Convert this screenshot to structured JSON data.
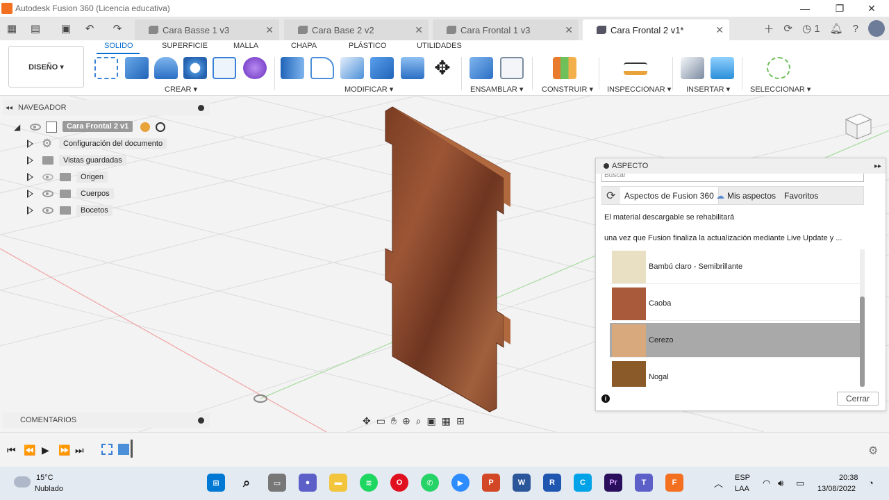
{
  "window": {
    "title": "Autodesk Fusion 360 (Licencia educativa)"
  },
  "tabs": [
    {
      "label": "Cara Basse 1 v3"
    },
    {
      "label": "Cara Base 2 v2"
    },
    {
      "label": "Cara Frontal 1 v3"
    },
    {
      "label": "Cara Frontal 2 v1*"
    }
  ],
  "header": {
    "job_count": "1"
  },
  "toolbar": {
    "design_label": "DISEÑO ▾",
    "workspace_tabs": [
      "SOLIDO",
      "SUPERFICIE",
      "MALLA",
      "CHAPA",
      "PLÁSTICO",
      "UTILIDADES"
    ],
    "groups": [
      "CREAR ▾",
      "MODIFICAR ▾",
      "ENSAMBLAR ▾",
      "CONSTRUIR ▾",
      "INSPECCIONAR ▾",
      "INSERTAR ▾",
      "SELECCIONAR ▾"
    ]
  },
  "navigator": {
    "header": "NAVEGADOR",
    "root": "Cara Frontal 2 v1",
    "items": [
      {
        "label": "Configuración del documento"
      },
      {
        "label": "Vistas guardadas"
      },
      {
        "label": "Origen"
      },
      {
        "label": "Cuerpos"
      },
      {
        "label": "Bocetos"
      }
    ]
  },
  "comments": {
    "label": "COMENTARIOS"
  },
  "aspect_panel": {
    "title": "ASPECTO",
    "search_placeholder": "Buscar",
    "tabs": [
      "Aspectos de Fusion 360",
      "Mis aspectos",
      "Favoritos"
    ],
    "message_line1": "El material descargable se rehabilitará",
    "message_line2": "una vez que Fusion finaliza la actualización mediante Live Update y ...",
    "materials": [
      {
        "name": "Bambú claro - Semibrillante",
        "color": "#e9dfc2",
        "selected": false
      },
      {
        "name": "Caoba",
        "color": "#a85a3a",
        "selected": false
      },
      {
        "name": "Cerezo",
        "color": "#d7a97c",
        "selected": true
      },
      {
        "name": "Nogal",
        "color": "#8a5a28",
        "selected": false
      }
    ],
    "close_label": "Cerrar"
  },
  "taskbar": {
    "weather_temp": "15°C",
    "weather_desc": "Nublado",
    "lang_line1": "ESP",
    "lang_line2": "LAA",
    "time": "20:38",
    "date": "13/08/2022"
  },
  "colors": {
    "accent": "#0a6ed1",
    "wood": "#8c4a2c"
  }
}
